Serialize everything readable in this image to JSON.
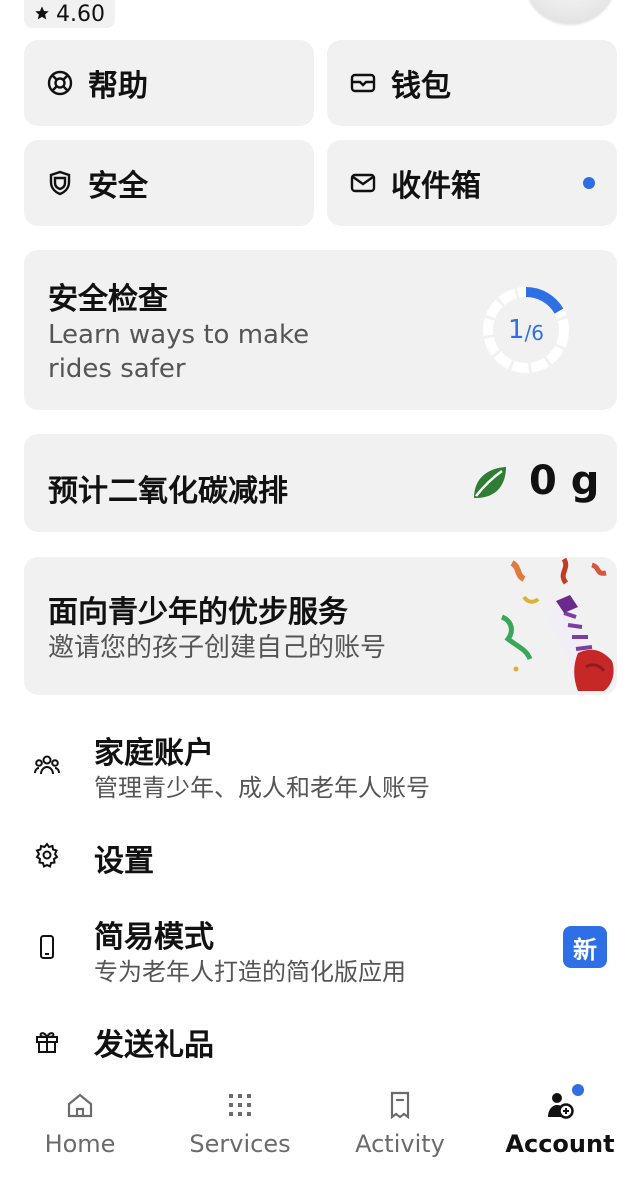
{
  "profile": {
    "rating": "4.60",
    "rating_icon": "star-icon"
  },
  "tiles": {
    "help": {
      "label": "帮助",
      "icon": "lifebuoy-icon"
    },
    "wallet": {
      "label": "钱包",
      "icon": "wallet-icon"
    },
    "safety": {
      "label": "安全",
      "icon": "shield-icon"
    },
    "inbox": {
      "label": "收件箱",
      "icon": "mail-icon",
      "has_unread": true
    }
  },
  "safety_check": {
    "title": "安全检查",
    "subtitle_line1": "Learn ways to make",
    "subtitle_line2": "rides safer",
    "progress_done": "1",
    "progress_total": "/6",
    "progress_fraction": 0.1667
  },
  "co2": {
    "label": "预计二氧化碳减排",
    "value": "0 g",
    "icon": "leaf-icon"
  },
  "teen": {
    "title": "面向青少年的优步服务",
    "subtitle": "邀请您的孩子创建自己的账号"
  },
  "menu": {
    "family": {
      "title": "家庭账户",
      "subtitle": "管理青少年、成人和老年人账号",
      "icon": "people-icon"
    },
    "settings": {
      "title": "设置",
      "icon": "gear-icon"
    },
    "simple": {
      "title": "简易模式",
      "subtitle": "专为老年人打造的简化版应用",
      "icon": "phone-icon",
      "badge": "新"
    },
    "gift": {
      "title": "发送礼品",
      "icon": "gift-icon"
    }
  },
  "tabbar": {
    "home": "Home",
    "services": "Services",
    "activity": "Activity",
    "account": "Account",
    "active": "account"
  },
  "colors": {
    "accent": "#2f6fe6",
    "tile_bg": "#f1f1f1",
    "leaf": "#2e7d32"
  }
}
